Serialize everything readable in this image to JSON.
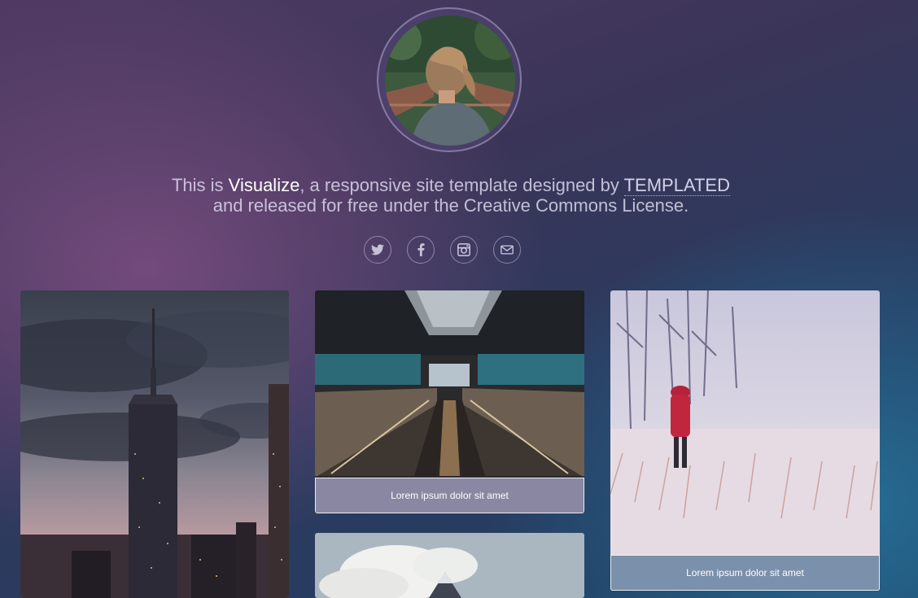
{
  "intro": {
    "prefix": "This is",
    "brand": "Visualize",
    "middle": ", a responsive site template designed by",
    "author": "TEMPLATED",
    "line2": "and released for free under the Creative Commons License."
  },
  "socials": [
    {
      "name": "twitter-icon"
    },
    {
      "name": "facebook-icon"
    },
    {
      "name": "instagram-icon"
    },
    {
      "name": "email-icon"
    }
  ],
  "gallery": {
    "captions": [
      "Lorem ipsum dolor sit amet",
      "Lorem ipsum dolor sit amet"
    ]
  },
  "colors": {
    "caption_bg_1": "#8a87a2",
    "caption_bg_2": "#7a90ab"
  }
}
